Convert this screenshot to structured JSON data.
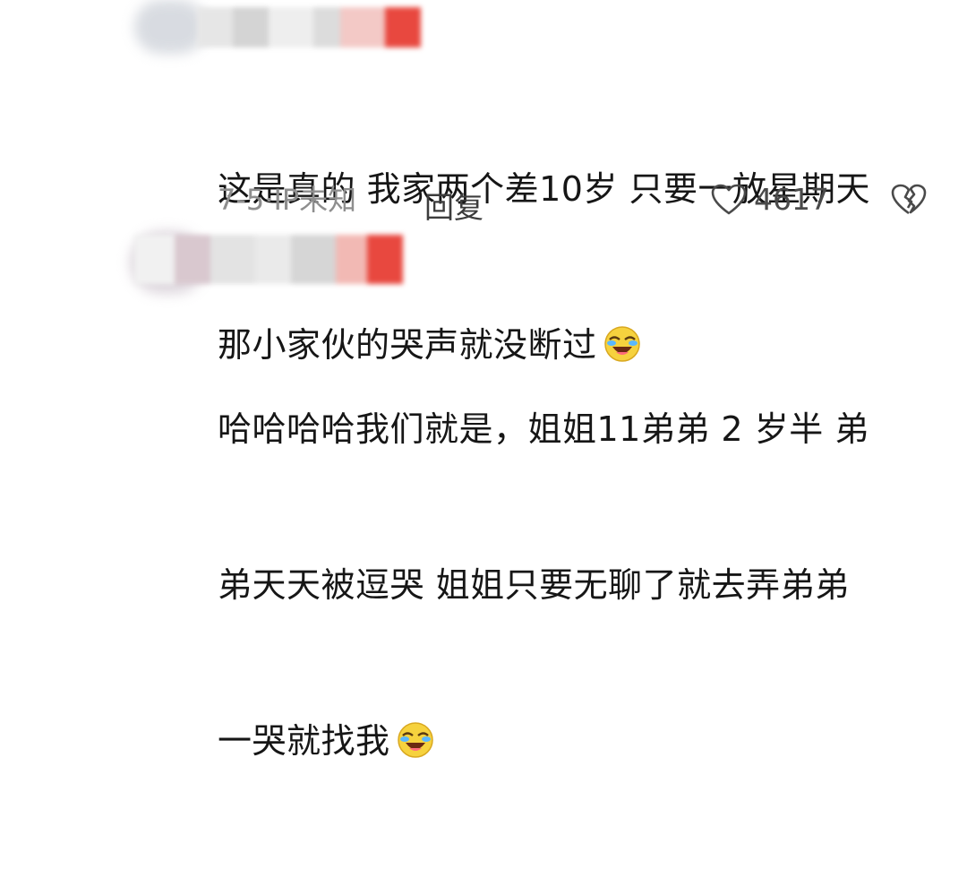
{
  "comments": [
    {
      "text_lines": [
        "这是真的 我家两个差10岁 只要一放星期天",
        "那小家伙的哭声就没断过"
      ],
      "emoji": "crying-laughing-emoji",
      "meta": "7-5·IP未知",
      "reply_label": "回复",
      "like_count": "4617",
      "like_icon": "heart-outline-icon",
      "dislike_icon": "broken-heart-icon"
    },
    {
      "text_lines": [
        "哈哈哈哈我们就是，姐姐11弟弟 2 岁半 弟",
        "弟天天被逗哭 姐姐只要无聊了就去弄弟弟",
        "一哭就找我"
      ],
      "emoji": "crying-laughing-emoji"
    }
  ],
  "colors": {
    "accent_red": "#e8483f",
    "meta_gray": "#8e8e8e"
  }
}
